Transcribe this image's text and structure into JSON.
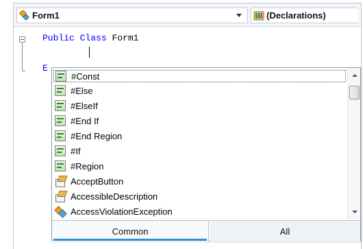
{
  "navbar": {
    "class_combo": {
      "label": "Form1",
      "icon": "class-icon"
    },
    "member_combo": {
      "label": "(Declarations)",
      "icon": "declarations-icon"
    }
  },
  "code": {
    "line1": {
      "keyword1": "Public",
      "keyword2": "Class",
      "name": "Form1"
    },
    "partial_line": "E"
  },
  "completion": {
    "items": [
      {
        "label": "#Const",
        "icon": "snippet-icon",
        "selected": true
      },
      {
        "label": "#Else",
        "icon": "snippet-icon"
      },
      {
        "label": "#ElseIf",
        "icon": "snippet-icon"
      },
      {
        "label": "#End If",
        "icon": "snippet-icon"
      },
      {
        "label": "#End Region",
        "icon": "snippet-icon"
      },
      {
        "label": "#If",
        "icon": "snippet-icon"
      },
      {
        "label": "#Region",
        "icon": "snippet-icon"
      },
      {
        "label": "AcceptButton",
        "icon": "property-icon"
      },
      {
        "label": "AccessibleDescription",
        "icon": "property-icon"
      },
      {
        "label": "AccessViolationException",
        "icon": "class-icon"
      }
    ],
    "tabs": {
      "common": "Common",
      "all": "All"
    }
  }
}
